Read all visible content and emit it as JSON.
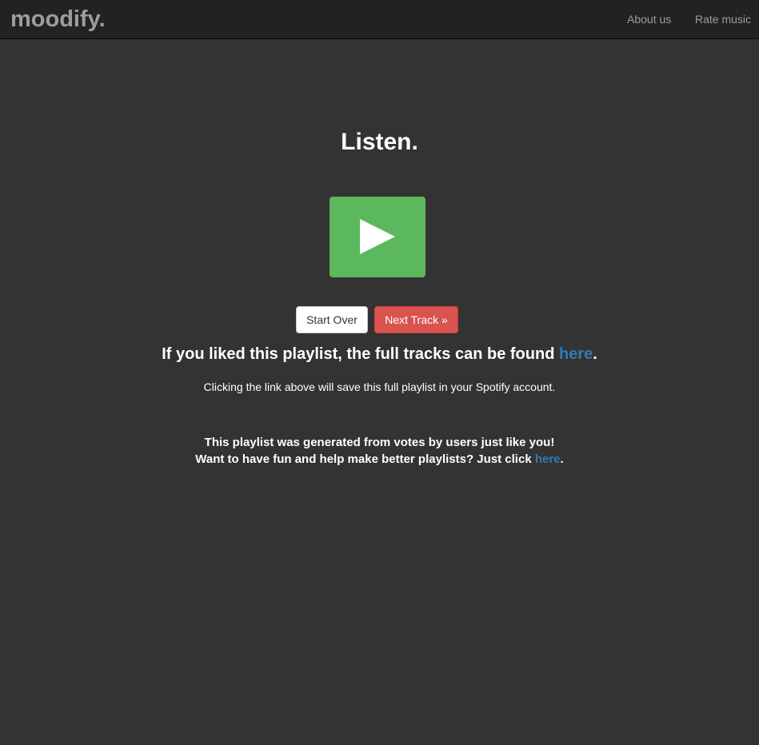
{
  "navbar": {
    "brand": "moodify.",
    "links": [
      {
        "label": "About us"
      },
      {
        "label": "Rate music"
      }
    ]
  },
  "main": {
    "heading": "Listen.",
    "play_icon": "play-icon",
    "buttons": {
      "start_over": "Start Over",
      "next_track": "Next Track »"
    },
    "liked": {
      "before": "If you liked this playlist, the full tracks can be found ",
      "link": "here",
      "after": "."
    },
    "save_note": "Clicking the link above will save this full playlist in your Spotify account.",
    "generated": {
      "line1": "This playlist was generated from votes by users just like you!",
      "line2_before": "Want to have fun and help make better playlists? Just click ",
      "line2_link": "here",
      "line2_after": "."
    }
  },
  "colors": {
    "background": "#333333",
    "navbar": "#222222",
    "nav_text": "#9d9d9d",
    "play_green": "#5cb85c",
    "next_red": "#d9534f",
    "link_blue": "#337ab7"
  }
}
